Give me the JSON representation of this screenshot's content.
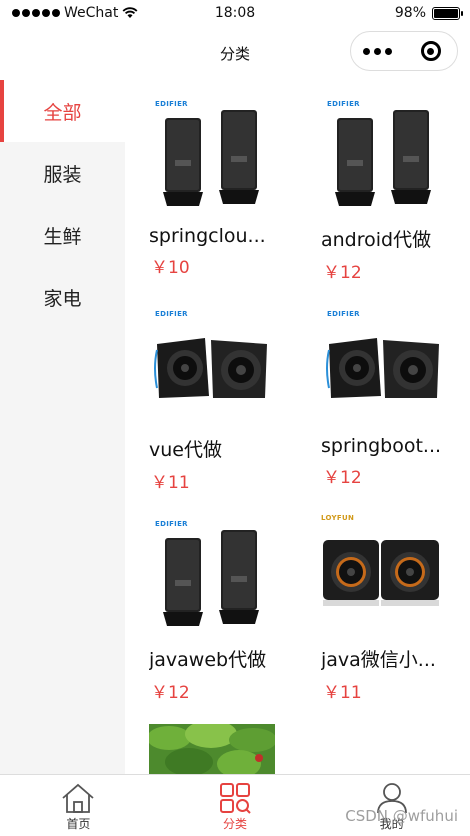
{
  "status_bar": {
    "carrier": "WeChat",
    "time": "18:08",
    "battery": "98%",
    "battery_level": 0.98
  },
  "nav": {
    "title": "分类"
  },
  "sidebar": {
    "items": [
      {
        "label": "全部",
        "active": true
      },
      {
        "label": "服装",
        "active": false
      },
      {
        "label": "生鲜",
        "active": false
      },
      {
        "label": "家电",
        "active": false
      }
    ]
  },
  "products": [
    {
      "name": "springclou...",
      "price": "￥10",
      "image": "speaker-tower-black",
      "brand": "EDIFIER"
    },
    {
      "name": "android代做",
      "price": "￥12",
      "image": "speaker-tower-black",
      "brand": "EDIFIER"
    },
    {
      "name": "vue代做",
      "price": "￥11",
      "image": "speaker-round-black",
      "brand": "EDIFIER"
    },
    {
      "name": "springboot...",
      "price": "￥12",
      "image": "speaker-round-black",
      "brand": "EDIFIER"
    },
    {
      "name": "javaweb代做",
      "price": "￥12",
      "image": "speaker-tower-black",
      "brand": "EDIFIER"
    },
    {
      "name": "java微信小...",
      "price": "￥11",
      "image": "speaker-cube-black",
      "brand": "LOYFUN"
    },
    {
      "name": "",
      "price": "",
      "image": "green-plants",
      "brand": ""
    }
  ],
  "tab_bar": {
    "tabs": [
      {
        "label": "首页",
        "icon": "home-icon",
        "active": false
      },
      {
        "label": "分类",
        "icon": "category-icon",
        "active": true
      },
      {
        "label": "我的",
        "icon": "user-icon",
        "active": false
      }
    ]
  },
  "watermark": "CSDN @wfuhui",
  "colors": {
    "accent": "#e64340",
    "sidebar_bg": "#f5f5f5"
  }
}
